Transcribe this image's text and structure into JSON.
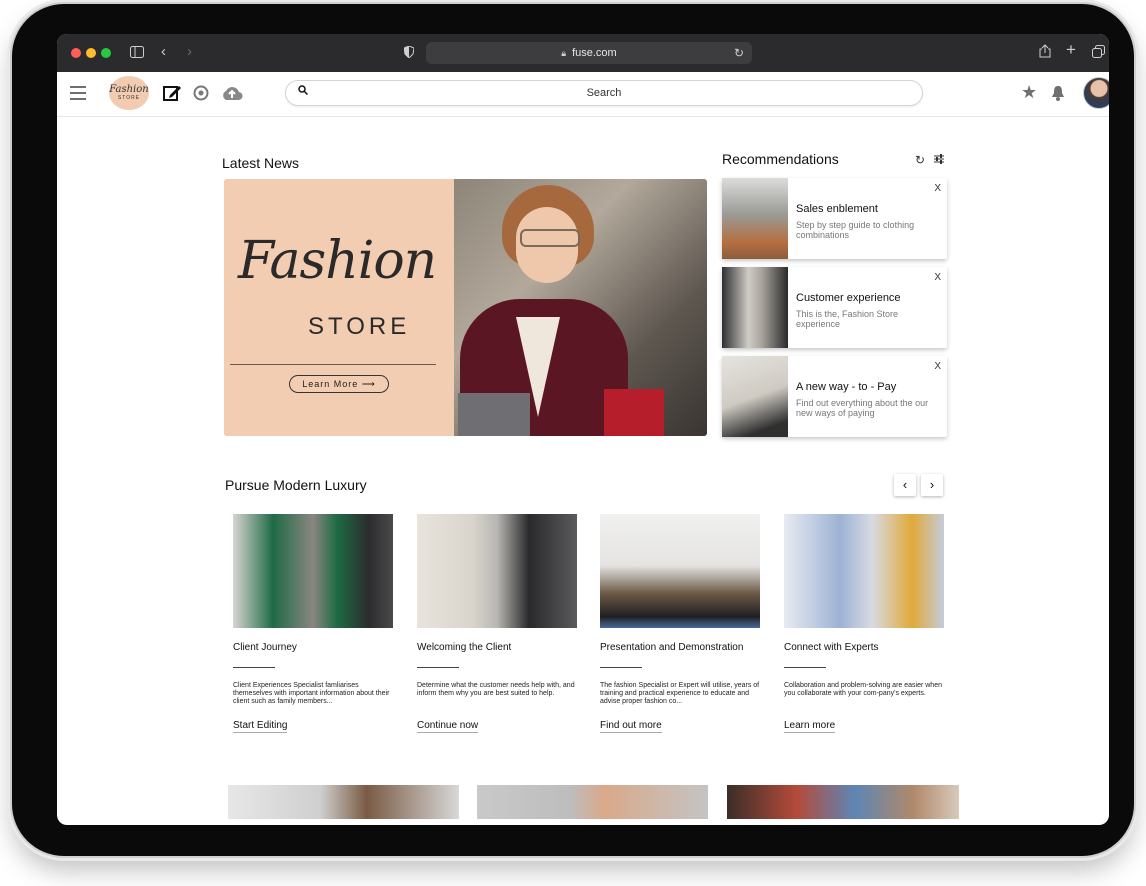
{
  "browser": {
    "url": "fuse.com"
  },
  "header": {
    "logo": {
      "line1": "Fashion",
      "line2": "STORE"
    },
    "search_placeholder": "Search"
  },
  "latest_news": {
    "title": "Latest News",
    "hero": {
      "script": "Fashion",
      "store": "STORE",
      "button": "Learn More"
    }
  },
  "recommendations": {
    "title": "Recommendations",
    "items": [
      {
        "title": "Sales enblement",
        "desc": "Step by step guide to clothing combinations",
        "close": "X"
      },
      {
        "title": "Customer experience",
        "desc": "This is the, Fashion Store experience",
        "close": "X"
      },
      {
        "title": "A new way - to - Pay",
        "desc": "Find out everything about the our new ways of paying",
        "close": "X"
      }
    ]
  },
  "luxury": {
    "title": "Pursue Modern Luxury",
    "cards": [
      {
        "title": "Client Journey",
        "desc": "Client Experiences Specialist famliarises themeselves with important information about their client such as family members...",
        "link": "Start Editing"
      },
      {
        "title": "Welcoming the Client",
        "desc": "Determine what the customer needs help with, and inform them why you are best suited to help.",
        "link": "Continue now"
      },
      {
        "title": "Presentation and Demonstration",
        "desc": "The fashion Specialist or Expert will utilise, years of training and practical experience to educate and advise proper fashion co...",
        "link": "Find out more"
      },
      {
        "title": "Connect with Experts",
        "desc": "Collaboration and problem-solving are easier when you collaborate with your com-pany's experts.",
        "link": "Learn more"
      }
    ]
  }
}
